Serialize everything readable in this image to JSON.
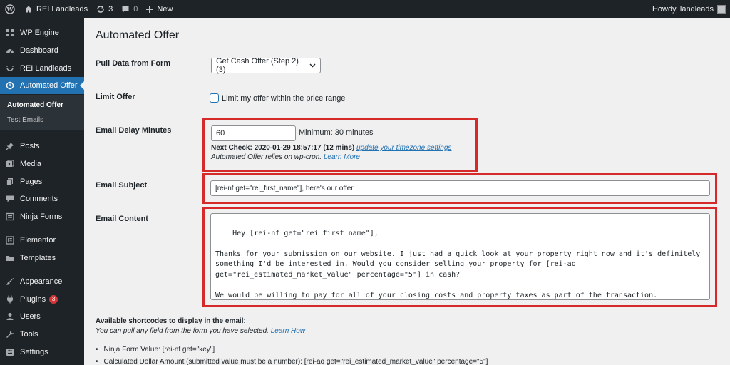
{
  "adminbar": {
    "site_name": "REI Landleads",
    "updates_count": "3",
    "comments_count": "0",
    "new_label": "New",
    "howdy": "Howdy, landleads"
  },
  "sidebar": {
    "items": [
      {
        "label": "WP Engine",
        "icon": "grid-icon"
      },
      {
        "label": "Dashboard",
        "icon": "dashboard-icon"
      },
      {
        "label": "REI Landleads",
        "icon": "smile-icon"
      },
      {
        "label": "Automated Offer",
        "icon": "history-icon"
      },
      {
        "label": "Posts",
        "icon": "pin-icon"
      },
      {
        "label": "Media",
        "icon": "media-icon"
      },
      {
        "label": "Pages",
        "icon": "pages-icon"
      },
      {
        "label": "Comments",
        "icon": "comment-icon"
      },
      {
        "label": "Ninja Forms",
        "icon": "form-icon"
      },
      {
        "label": "Elementor",
        "icon": "elementor-icon"
      },
      {
        "label": "Templates",
        "icon": "folder-icon"
      },
      {
        "label": "Appearance",
        "icon": "brush-icon"
      },
      {
        "label": "Plugins",
        "icon": "plugin-icon",
        "badge": "3"
      },
      {
        "label": "Users",
        "icon": "user-icon"
      },
      {
        "label": "Tools",
        "icon": "wrench-icon"
      },
      {
        "label": "Settings",
        "icon": "settings-icon"
      }
    ],
    "submenu": [
      "Automated Offer",
      "Test Emails"
    ]
  },
  "main": {
    "title": "Automated Offer",
    "pull_data_label": "Pull Data from Form",
    "pull_data_value": "Get Cash Offer (Step 2) (3)",
    "limit_offer_label": "Limit Offer",
    "limit_offer_checkbox": "Limit my offer within the price range",
    "email_delay_label": "Email Delay Minutes",
    "email_delay_value": "60",
    "email_delay_min": "Minimum: 30 minutes",
    "next_check": "Next Check: 2020-01-29 18:57:17 (12 mins)",
    "update_tz_link": "update your timezone settings",
    "cron_note": "Automated Offer relies on wp-cron.",
    "learn_more": "Learn More",
    "email_subject_label": "Email Subject",
    "email_subject_value": "[rei-nf get=\"rei_first_name\"], here's our offer.",
    "email_content_label": "Email Content",
    "email_content_value": "Hey [rei-nf get=\"rei_first_name\"],\n\nThanks for your submission on our website. I just had a quick look at your property right now and it's definitely something I'd be interested in. Would you consider selling your property for [rei-ao get=\"rei_estimated_market_value\" percentage=\"5\"] in cash?\n\nWe would be willing to pay for all of your closing costs and property taxes as part of the transaction.",
    "shortcodes_title": "Available shortcodes to display in the email:",
    "shortcodes_desc": "You can pull any field from the form you have selected.",
    "shortcodes_learn_how": "Learn How",
    "shortcodes": [
      "Ninja Form Value: [rei-nf get=\"key\"]",
      "Calculated Dollar Amount (submitted value must be a number): [rei-ao get=\"rei_estimated_market_value\" percentage=\"5\"]"
    ]
  },
  "colors": {
    "admin_bg": "#1d2327",
    "accent": "#2271b1",
    "highlight_box": "#d62a2a",
    "badge": "#d63638"
  }
}
